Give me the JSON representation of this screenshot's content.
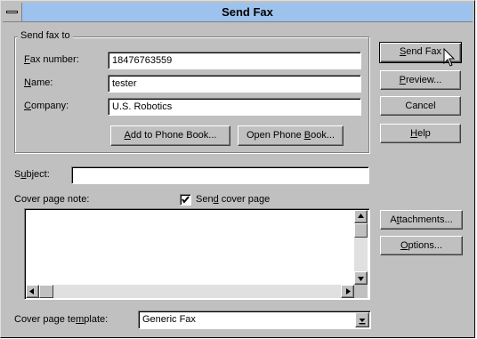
{
  "window": {
    "title": "Send Fax"
  },
  "send_to": {
    "legend": "Send fax to",
    "fax_label_pre": "",
    "fax_label_key": "F",
    "fax_label_post": "ax number:",
    "fax_value": "18476763559",
    "name_label_pre": "",
    "name_label_key": "N",
    "name_label_post": "ame:",
    "name_value": "tester",
    "company_label_pre": "",
    "company_label_key": "C",
    "company_label_post": "ompany:",
    "company_value": "U.S. Robotics",
    "add_phone_pre": "",
    "add_phone_key": "A",
    "add_phone_post": "dd to Phone Book...",
    "open_phone_pre": "Open Phone ",
    "open_phone_key": "B",
    "open_phone_post": "ook..."
  },
  "buttons": {
    "send_pre": "",
    "send_key": "S",
    "send_post": "end Fax",
    "preview_pre": "",
    "preview_key": "P",
    "preview_post": "review...",
    "cancel": "Cancel",
    "help_pre": "",
    "help_key": "H",
    "help_post": "elp",
    "attachments_pre": "A",
    "attachments_key": "t",
    "attachments_post": "tachments...",
    "options_pre": "",
    "options_key": "O",
    "options_post": "ptions..."
  },
  "subject": {
    "label_pre": "S",
    "label_key": "u",
    "label_post": "bject:",
    "value": ""
  },
  "cover_note": {
    "label": "Cover page note:",
    "checkbox_checked": true,
    "checkbox_label_pre": "Sen",
    "checkbox_label_key": "d",
    "checkbox_label_post": " cover page",
    "text": ""
  },
  "template": {
    "label_pre": "Cover page te",
    "label_key": "m",
    "label_post": "plate:",
    "value": "Generic Fax"
  },
  "icons": {
    "system_menu": "system-menu-icon",
    "checkmark": "checkmark-icon",
    "scroll_up": "arrow-up-icon",
    "scroll_down": "arrow-down-icon",
    "scroll_left": "arrow-left-icon",
    "scroll_right": "arrow-right-icon",
    "dropdown": "arrow-down-icon",
    "cursor": "mouse-cursor-icon"
  },
  "colors": {
    "titlebar": "#9ec2ee",
    "face": "#c0c0c0"
  }
}
